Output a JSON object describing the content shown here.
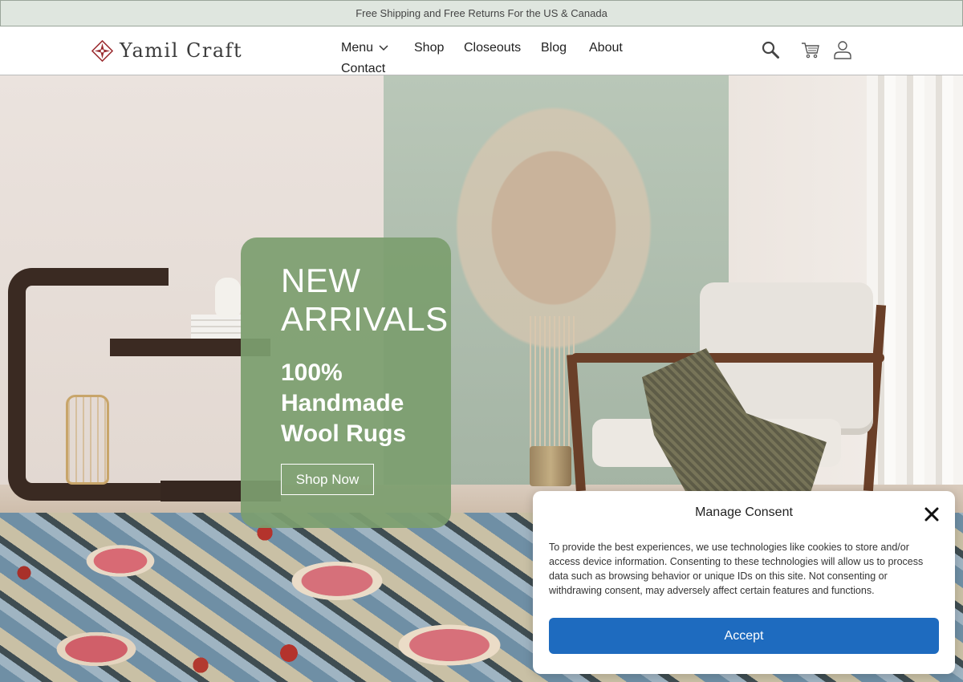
{
  "announcement": {
    "text": "Free Shipping and Free Returns For the US & Canada"
  },
  "brand": {
    "name": "Yamil Craft",
    "logo_icon": "star-diamond-logo",
    "logo_color": "#9a2a2e"
  },
  "nav": {
    "menu": "Menu",
    "shop": "Shop",
    "closeouts": "Closeouts",
    "blog": "Blog",
    "about": "About",
    "contact": "Contact"
  },
  "header_icons": [
    "search-icon",
    "cart-icon",
    "user-icon"
  ],
  "hero": {
    "title_line1": "NEW",
    "title_line2": "ARRIVALS",
    "subtitle_line1": "100%",
    "subtitle_line2": "Handmade",
    "subtitle_line3": "Wool Rugs",
    "cta": "Shop Now",
    "card_color": "#7c9e6f"
  },
  "consent": {
    "title": "Manage Consent",
    "body": "To provide the best experiences, we use technologies like cookies to store and/or access device information. Consenting to these technologies will allow us to process data such as browsing behavior or unique IDs on this site. Not consenting or withdrawing consent, may adversely affect certain features and functions.",
    "accept": "Accept",
    "accent": "#1e6bbf"
  }
}
